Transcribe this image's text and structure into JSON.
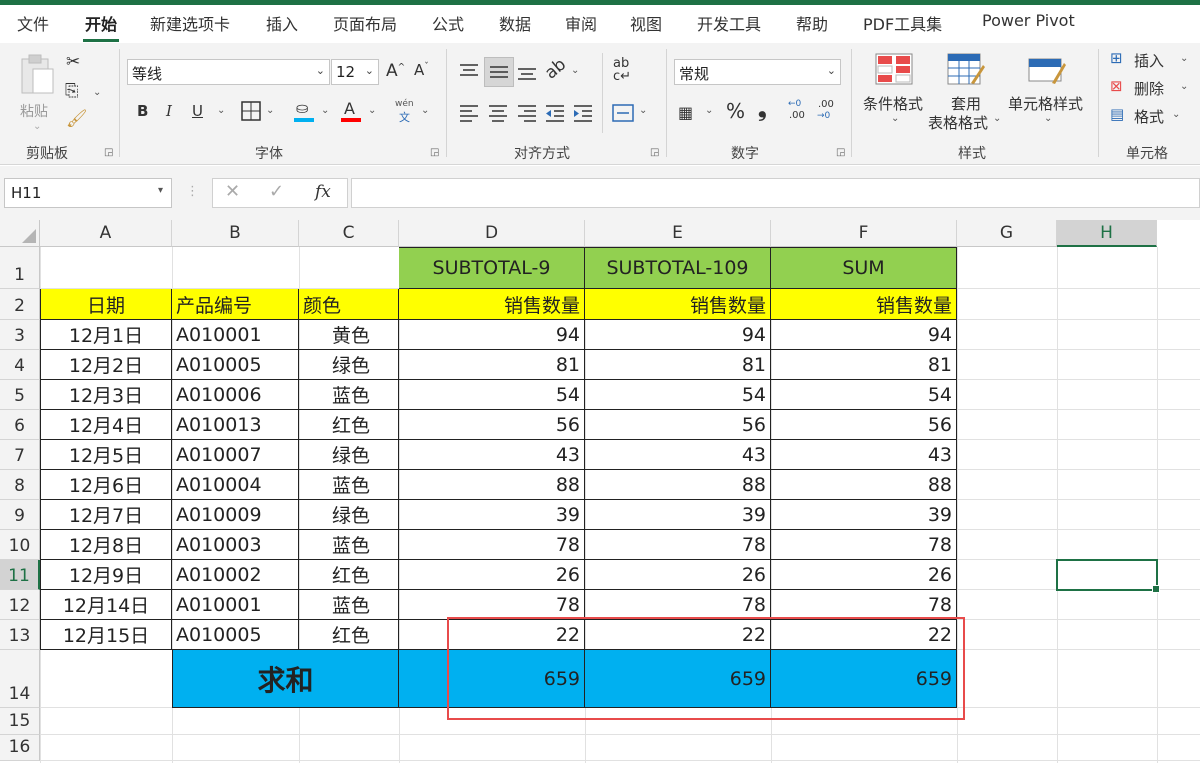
{
  "tabs": [
    "文件",
    "开始",
    "新建选项卡",
    "插入",
    "页面布局",
    "公式",
    "数据",
    "审阅",
    "视图",
    "开发工具",
    "帮助",
    "PDF工具集",
    "Power Pivot"
  ],
  "active_tab": "开始",
  "ribbon": {
    "clipboard": {
      "paste": "粘贴",
      "label": "剪贴板"
    },
    "font": {
      "name": "等线",
      "size": "12",
      "grow": "A",
      "shrink": "A",
      "bold": "B",
      "italic": "I",
      "underline": "U",
      "phonetic_top": "wén",
      "phonetic_bottom": "文",
      "label": "字体"
    },
    "alignment": {
      "label": "对齐方式"
    },
    "number": {
      "format": "常规",
      "percent": "%",
      "comma": "❟",
      "inc_decimal": ".00",
      "dec_decimal": ".00",
      "label": "数字"
    },
    "styles": {
      "conditional": "条件格式",
      "table_top": "套用",
      "table_bottom": "表格格式",
      "cell_styles": "单元格样式",
      "label": "样式"
    },
    "cells": {
      "insert": "插入",
      "delete": "删除",
      "format": "格式",
      "label": "单元格"
    }
  },
  "formula_bar": {
    "name_box": "H11",
    "fx": "fx",
    "content": ""
  },
  "columns": [
    "A",
    "B",
    "C",
    "D",
    "E",
    "F",
    "G",
    "H"
  ],
  "rows": [
    "1",
    "2",
    "3",
    "4",
    "5",
    "6",
    "7",
    "8",
    "9",
    "10",
    "11",
    "12",
    "13",
    "14",
    "15",
    "16"
  ],
  "header_row1": [
    "SUBTOTAL-9",
    "SUBTOTAL-109",
    "SUM"
  ],
  "header_row2": [
    "日期",
    "产品编号",
    "颜色",
    "销售数量",
    "销售数量",
    "销售数量"
  ],
  "data": [
    [
      "12月1日",
      "A010001",
      "黄色",
      "94",
      "94",
      "94"
    ],
    [
      "12月2日",
      "A010005",
      "绿色",
      "81",
      "81",
      "81"
    ],
    [
      "12月3日",
      "A010006",
      "蓝色",
      "54",
      "54",
      "54"
    ],
    [
      "12月4日",
      "A010013",
      "红色",
      "56",
      "56",
      "56"
    ],
    [
      "12月5日",
      "A010007",
      "绿色",
      "43",
      "43",
      "43"
    ],
    [
      "12月6日",
      "A010004",
      "蓝色",
      "88",
      "88",
      "88"
    ],
    [
      "12月7日",
      "A010009",
      "绿色",
      "39",
      "39",
      "39"
    ],
    [
      "12月8日",
      "A010003",
      "蓝色",
      "78",
      "78",
      "78"
    ],
    [
      "12月9日",
      "A010002",
      "红色",
      "26",
      "26",
      "26"
    ],
    [
      "12月14日",
      "A010001",
      "蓝色",
      "78",
      "78",
      "78"
    ],
    [
      "12月15日",
      "A010005",
      "红色",
      "22",
      "22",
      "22"
    ]
  ],
  "total": {
    "label": "求和",
    "values": [
      "659",
      "659",
      "659"
    ]
  },
  "colors": {
    "accent": "#1e7145",
    "green_header": "#92d050",
    "yellow_header": "#ffff00",
    "blue_total": "#00b0f0",
    "highlight": "#e84b4b"
  }
}
